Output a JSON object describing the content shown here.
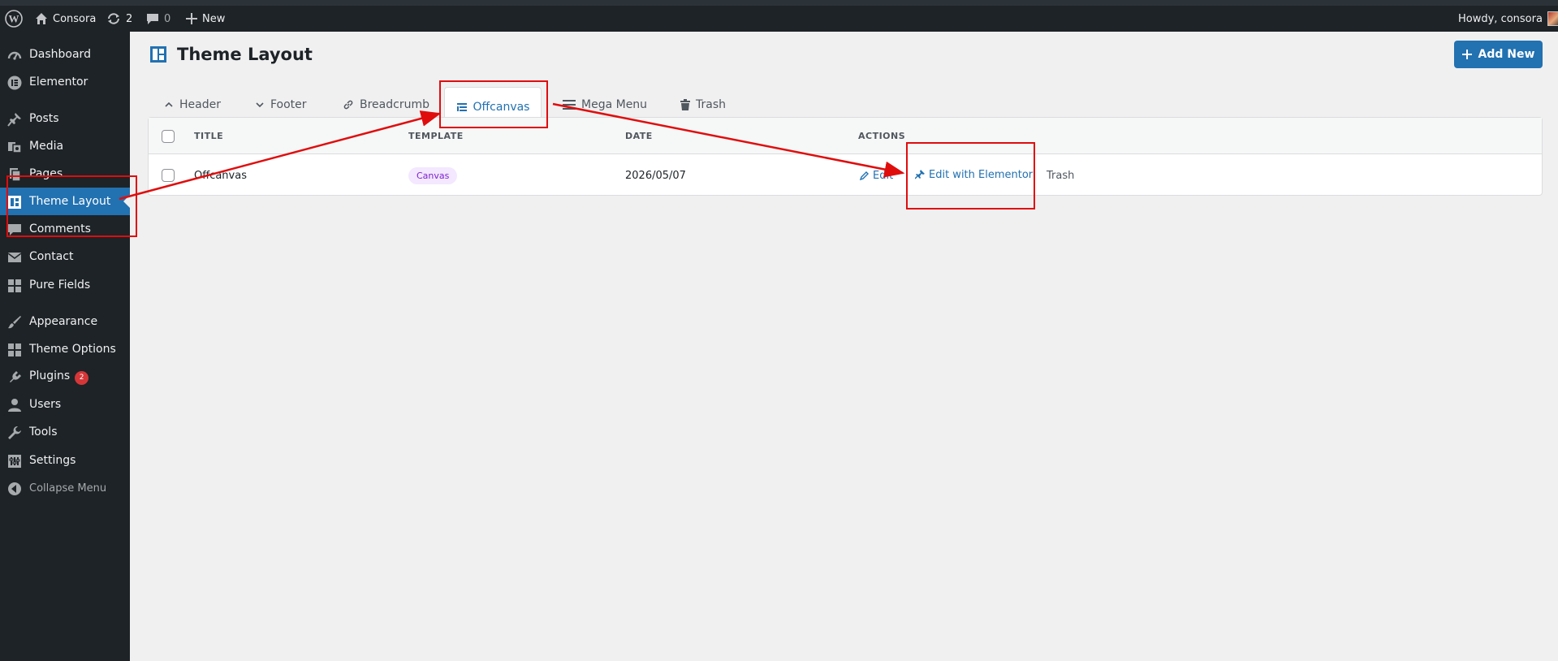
{
  "adminbar": {
    "site_name": "Consora",
    "updates_count": "2",
    "comments_count": "0",
    "new_label": "New",
    "howdy": "Howdy, consora"
  },
  "sidebar": {
    "items": [
      {
        "label": "Dashboard",
        "icon": "dashboard-icon"
      },
      {
        "label": "Elementor",
        "icon": "elementor-icon"
      },
      {
        "label": "Posts",
        "icon": "pin-icon"
      },
      {
        "label": "Media",
        "icon": "media-icon"
      },
      {
        "label": "Pages",
        "icon": "pages-icon"
      },
      {
        "label": "Theme Layout",
        "icon": "layout-icon"
      },
      {
        "label": "Comments",
        "icon": "comment-icon"
      },
      {
        "label": "Contact",
        "icon": "mail-icon"
      },
      {
        "label": "Pure Fields",
        "icon": "grid-icon"
      },
      {
        "label": "Appearance",
        "icon": "brush-icon"
      },
      {
        "label": "Theme Options",
        "icon": "grid-icon"
      },
      {
        "label": "Plugins",
        "icon": "plugin-icon",
        "badge": "2"
      },
      {
        "label": "Users",
        "icon": "user-icon"
      },
      {
        "label": "Tools",
        "icon": "wrench-icon"
      },
      {
        "label": "Settings",
        "icon": "settings-icon"
      },
      {
        "label": "Collapse Menu",
        "icon": "collapse-icon"
      }
    ]
  },
  "page": {
    "title": "Theme Layout",
    "add_new": "Add New"
  },
  "tabs": [
    {
      "label": "Header"
    },
    {
      "label": "Footer"
    },
    {
      "label": "Breadcrumb"
    },
    {
      "label": "Offcanvas"
    },
    {
      "label": "Mega Menu"
    },
    {
      "label": "Trash"
    }
  ],
  "table": {
    "columns": [
      "TITLE",
      "TEMPLATE",
      "DATE",
      "ACTIONS"
    ],
    "rows": [
      {
        "title": "Offcanvas",
        "template": "Canvas",
        "date": "2026/05/07",
        "edit": "Edit",
        "edit_elementor": "Edit with Elementor",
        "trash": "Trash"
      }
    ]
  },
  "colors": {
    "admin_dark": "#1d2327",
    "accent_blue": "#2271b1",
    "annotation_red": "#e00d0d",
    "badge_red": "#d63638"
  }
}
